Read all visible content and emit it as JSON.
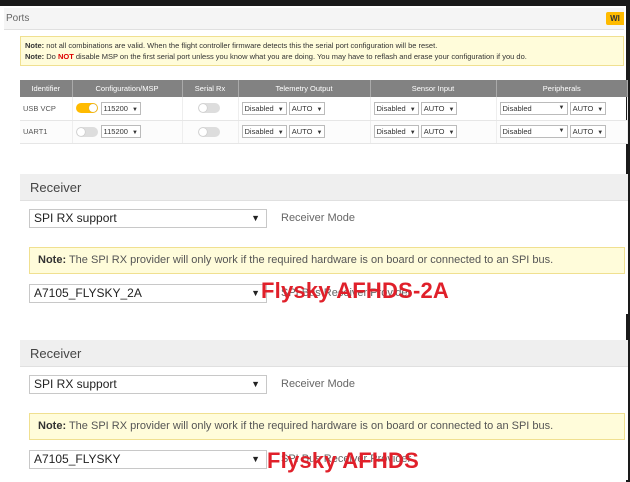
{
  "ports": {
    "title": "Ports",
    "wiki_badge": "WI",
    "note_line1_bold": "Note:",
    "note_line1_text": " not all combinations are valid. When the flight controller firmware detects this the serial port configuration will be reset.",
    "note_line2_bold": "Note:",
    "note_line2_pre": " Do ",
    "note_line2_red": "NOT",
    "note_line2_post": " disable MSP on the first serial port unless you know what you are doing. You may have to reflash and erase your configuration if you do.",
    "columns": [
      "Identifier",
      "Configuration/MSP",
      "Serial Rx",
      "Telemetry Output",
      "Sensor Input",
      "Peripherals"
    ],
    "rows": [
      {
        "identifier": "USB VCP",
        "msp_on": true,
        "baud": "115200",
        "serial_rx_on": false,
        "telemetry": "Disabled",
        "telemetry_baud": "AUTO",
        "sensor": "Disabled",
        "sensor_baud": "AUTO",
        "peripheral": "Disabled",
        "peripheral_baud": "AUTO"
      },
      {
        "identifier": "UART1",
        "msp_on": false,
        "baud": "115200",
        "serial_rx_on": false,
        "telemetry": "Disabled",
        "telemetry_baud": "AUTO",
        "sensor": "Disabled",
        "sensor_baud": "AUTO",
        "peripheral": "Disabled",
        "peripheral_baud": "AUTO"
      }
    ]
  },
  "receiver1": {
    "title": "Receiver",
    "mode_select": "SPI RX support",
    "mode_label": "Receiver Mode",
    "note_bold": "Note:",
    "note_text": " The SPI RX provider will only work if the required hardware is on board or connected to an SPI bus.",
    "provider_select": "A7105_FLYSKY_2A",
    "provider_label": "SPI Bus Receiver Provider",
    "annotation": "Flysky AFHDS-2A"
  },
  "receiver2": {
    "title": "Receiver",
    "mode_select": "SPI RX support",
    "mode_label": "Receiver Mode",
    "note_bold": "Note:",
    "note_text": " The SPI RX provider will only work if the required hardware is on board or connected to an SPI bus.",
    "provider_select": "A7105_FLYSKY",
    "provider_label": "SPI Bus Receiver Provider",
    "annotation": "Flysky AFHDS"
  },
  "colors": {
    "accent": "#ffbb00",
    "annotation": "#e0202a",
    "table_header": "#828282",
    "note_bg": "#fffcda"
  }
}
